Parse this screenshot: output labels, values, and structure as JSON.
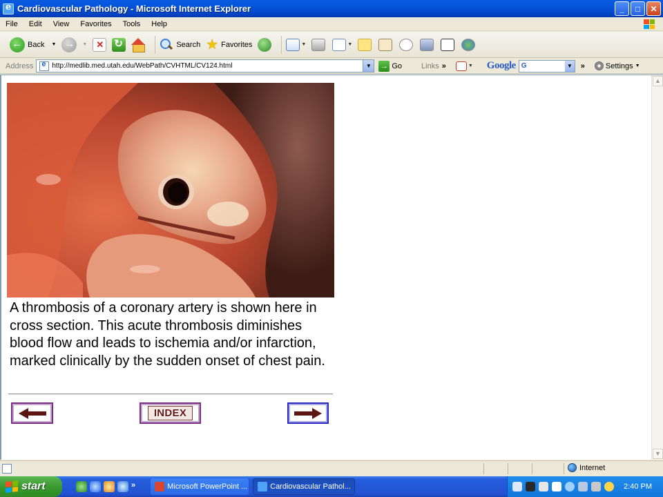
{
  "window": {
    "title": "Cardiovascular Pathology - Microsoft Internet Explorer",
    "minimize_glyph": "_",
    "maximize_glyph": "□",
    "close_glyph": "✕"
  },
  "menu": [
    "File",
    "Edit",
    "View",
    "Favorites",
    "Tools",
    "Help"
  ],
  "toolbar": {
    "back_label": "Back",
    "search_label": "Search",
    "favorites_label": "Favorites"
  },
  "address": {
    "label": "Address",
    "url": "http://medlib.med.utah.edu/WebPath/CVHTML/CV124.html",
    "go_label": "Go",
    "links_label": "Links"
  },
  "google_bar": {
    "logo": "Google",
    "search_value": "G",
    "settings_label": "Settings"
  },
  "page": {
    "caption": "A thrombosis of a coronary artery is shown here in cross section. This acute thrombosis diminishes blood flow and leads to ischemia and/or infarction, marked clinically by the sudden onset of chest pain.",
    "index_label": "INDEX"
  },
  "status": {
    "zone_label": "Internet"
  },
  "taskbar": {
    "start_label": "start",
    "tasks": [
      {
        "label": "Microsoft PowerPoint ..."
      },
      {
        "label": "Cardiovascular Pathol..."
      }
    ],
    "clock": "2:40 PM"
  },
  "colors": {
    "titlebar_blue": "#0454D8",
    "nav_border_purple": "#7C2C86",
    "nav_border_blue": "#2A2ABE",
    "arrow_maroon": "#5C1510"
  }
}
